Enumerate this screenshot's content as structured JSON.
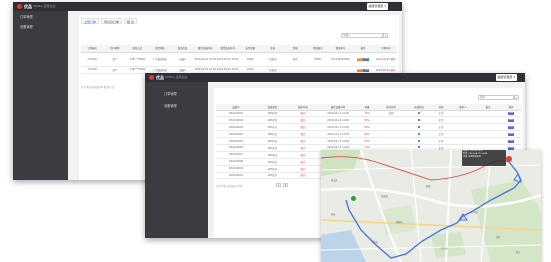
{
  "colors": {
    "topbar": "#2e3035",
    "sidebar": "#3a3c42",
    "accent_red": "#d83a3a",
    "route_blue": "#4a6ee0"
  },
  "back_window": {
    "logo_text": "优品",
    "tagline": "UMIKA 运营后台",
    "user_menu": "超级管理员 ▾",
    "sidebar": [
      "订单管理",
      "设备管理"
    ],
    "tabs": [
      "全部订单",
      "待付款订单",
      "租 赁"
    ],
    "search": {
      "placeholder": "请输入"
    },
    "table": {
      "headers": [
        "订单编号",
        "用户昵称",
        "联系方式",
        "收货地址",
        "商品信息",
        "租赁开始时间",
        "租赁结束时间",
        "支付金额",
        "状态",
        "物流",
        "物流编号",
        "物流单号",
        "操作",
        "下单时间"
      ],
      "rows": [
        [
          "C20190",
          "胡**",
          "138****0000",
          "广东省深圳市",
          "设备A",
          "2019-04-01 10:00",
          "2019-05-01 10:00",
          "¥299",
          "待发货",
          "顺丰",
          "SF001",
          "SF1234567890",
          "",
          "2019-04-01"
        ],
        [
          "C20190",
          "胡**",
          "138****0000",
          "广东省深圳市",
          "设备A",
          "2019-04-01 10:00",
          "2019-05-01 10:00",
          "¥299",
          "待发货",
          "",
          "",
          "",
          "",
          "2019-04-01"
        ]
      ],
      "action_labels": [
        "编辑",
        "发货"
      ],
      "delete_label": "删除"
    },
    "pager": "共 2 条记录  每页 10 条  第 1 页"
  },
  "front_window": {
    "logo_text": "优品",
    "tagline": "UMIKA 运营后台",
    "user_menu": "超级管理员 ▾",
    "sidebar": [
      "订单管理",
      "设备管理"
    ],
    "search": {
      "placeholder": "搜索"
    },
    "table": {
      "headers": [
        "设备号",
        "设备类型",
        "绑定状态",
        "绑定设备时间",
        "电量",
        "所在位置",
        "在线状态",
        "状态",
        "联系人",
        "备注",
        "操作"
      ],
      "rows": [
        [
          "DS2019001",
          "GPS定位",
          "绑定",
          "2019-04-11 14:08",
          "75%",
          "深圳",
          "",
          "正常",
          "",
          "",
          "查看"
        ],
        [
          "DS2019002",
          "GPS定位",
          "绑定",
          "2019-04-11 14:08",
          "80%",
          "",
          "",
          "正常",
          "",
          "",
          "查看"
        ],
        [
          "DS2019003",
          "GPS定位",
          "绑定",
          "2019-04-11 14:08",
          "90%",
          "",
          "",
          "正常",
          "",
          "",
          "查看"
        ],
        [
          "DS2019004",
          "GPS定位",
          "绑定",
          "2019-04-11 14:08",
          "60%",
          "",
          "",
          "正常",
          "",
          "",
          "查看"
        ],
        [
          "DS2019005",
          "GPS定位",
          "绑定",
          "2019-04-11 14:08",
          "55%",
          "",
          "",
          "正常",
          "",
          "",
          "查看"
        ],
        [
          "DS2019006",
          "GPS定位",
          "绑定",
          "2019-04-11 14:08",
          "70%",
          "",
          "",
          "正常",
          "",
          "",
          "查看"
        ],
        [
          "DS2019007",
          "GPS定位",
          "绑定",
          "2019-04-11 14:08",
          "85%",
          "",
          "",
          "正常",
          "",
          "",
          "查看"
        ],
        [
          "DS2019008",
          "GPS定位",
          "绑定",
          "2019-04-11 14:08",
          "65%",
          "",
          "",
          "正常",
          "",
          "",
          "查看"
        ],
        [
          "DS2019009",
          "GPS定位",
          "绑定",
          "2019-04-11 14:08",
          "50%",
          "",
          "",
          "正常",
          "",
          "",
          "查看"
        ],
        [
          "DS2019010",
          "GPS定位",
          "绑定",
          "2019-04-11 14:08",
          "95%",
          "",
          "",
          "正常",
          "",
          "",
          "查看"
        ]
      ]
    },
    "pager": "共 10 条记录  每页 10 条",
    "page_numbers": [
      "1",
      "2"
    ]
  },
  "map": {
    "popup_lines": [
      "设备号: DS2019001",
      "时间: 2019-04-11 14:08",
      "位置: 深圳市南山区"
    ],
    "labels": [
      "南山区",
      "科技园",
      "西丽",
      "大学城",
      "桃源村",
      "龙井",
      "白石洲",
      "华侨城",
      "前海",
      "蛇口"
    ]
  }
}
